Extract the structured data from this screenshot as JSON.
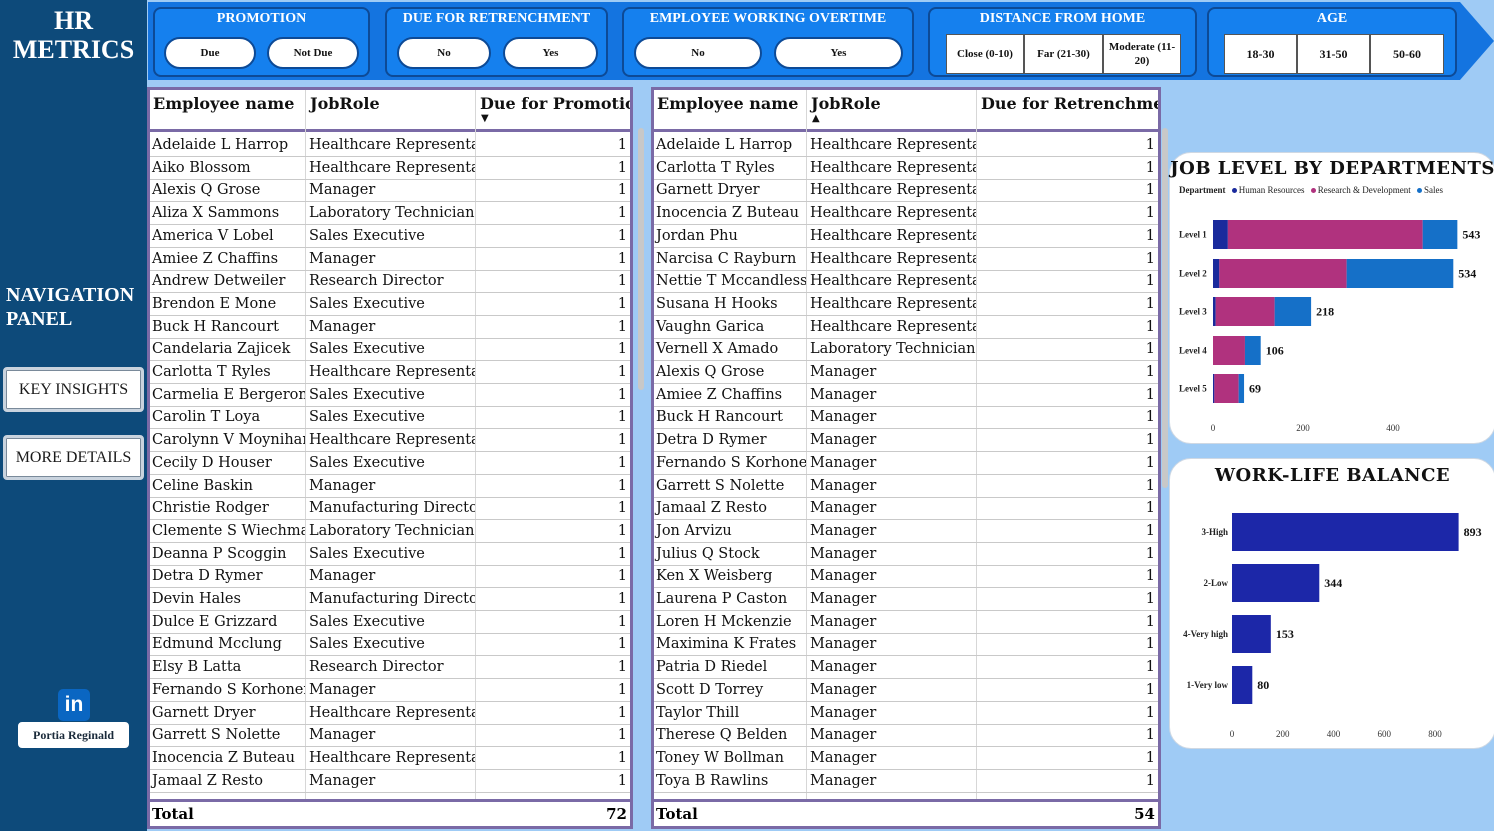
{
  "sidebar": {
    "title_line1": "HR",
    "title_line2": "METRICS",
    "nav_title_line1": "NAVIGATION",
    "nav_title_line2": "PANEL",
    "btn_key_insights": "KEY INSIGHTS",
    "btn_more_details": "MORE DETAILS",
    "linkedin_icon": "in",
    "author": "Portia Reginald"
  },
  "slicers": {
    "promotion": {
      "title": "PROMOTION",
      "options": [
        "Due",
        "Not Due"
      ]
    },
    "retrenchment": {
      "title": "DUE FOR RETRENCHMENT",
      "options": [
        "No",
        "Yes"
      ]
    },
    "overtime": {
      "title": "EMPLOYEE WORKING OVERTIME",
      "options": [
        "No",
        "Yes"
      ]
    },
    "distance": {
      "title": "DISTANCE FROM HOME",
      "options": [
        "Close (0-10)",
        "Far (21-30)",
        "Moderate (11-20)"
      ]
    },
    "age": {
      "title": "AGE",
      "options": [
        "18-30",
        "31-50",
        "50-60"
      ]
    }
  },
  "promotion_table": {
    "headers": [
      "Employee name",
      "JobRole",
      "Due for Promotion"
    ],
    "sort_indicator": "▼",
    "rows": [
      [
        "Adelaide L Harrop",
        "Healthcare Representative",
        "1"
      ],
      [
        "Aiko Blossom",
        "Healthcare Representative",
        "1"
      ],
      [
        "Alexis Q Grose",
        "Manager",
        "1"
      ],
      [
        "Aliza X Sammons",
        "Laboratory Technician",
        "1"
      ],
      [
        "America V Lobel",
        "Sales Executive",
        "1"
      ],
      [
        "Amiee Z Chaffins",
        "Manager",
        "1"
      ],
      [
        "Andrew Detweiler",
        "Research Director",
        "1"
      ],
      [
        "Brendon E Mone",
        "Sales Executive",
        "1"
      ],
      [
        "Buck H Rancourt",
        "Manager",
        "1"
      ],
      [
        "Candelaria Zajicek",
        "Sales Executive",
        "1"
      ],
      [
        "Carlotta T Ryles",
        "Healthcare Representative",
        "1"
      ],
      [
        "Carmelia E Bergeron",
        "Sales Executive",
        "1"
      ],
      [
        "Carolin T Loya",
        "Sales Executive",
        "1"
      ],
      [
        "Carolynn V Moynihan",
        "Healthcare Representative",
        "1"
      ],
      [
        "Cecily D Houser",
        "Sales Executive",
        "1"
      ],
      [
        "Celine Baskin",
        "Manager",
        "1"
      ],
      [
        "Christie Rodger",
        "Manufacturing Director",
        "1"
      ],
      [
        "Clemente S Wiechmann",
        "Laboratory Technician",
        "1"
      ],
      [
        "Deanna P Scoggin",
        "Sales Executive",
        "1"
      ],
      [
        "Detra D Rymer",
        "Manager",
        "1"
      ],
      [
        "Devin Hales",
        "Manufacturing Director",
        "1"
      ],
      [
        "Dulce E Grizzard",
        "Sales Executive",
        "1"
      ],
      [
        "Edmund Mcclung",
        "Sales Executive",
        "1"
      ],
      [
        "Elsy B Latta",
        "Research Director",
        "1"
      ],
      [
        "Fernando S Korhonen",
        "Manager",
        "1"
      ],
      [
        "Garnett Dryer",
        "Healthcare Representative",
        "1"
      ],
      [
        "Garrett S Nolette",
        "Manager",
        "1"
      ],
      [
        "Inocencia Z Buteau",
        "Healthcare Representative",
        "1"
      ],
      [
        "Jamaal Z Resto",
        "Manager",
        "1"
      ]
    ],
    "total_label": "Total",
    "total_value": "72"
  },
  "retrenchment_table": {
    "headers": [
      "Employee name",
      "JobRole",
      "Due for Retrenchment"
    ],
    "sort_indicator": "▲",
    "rows": [
      [
        "Adelaide L Harrop",
        "Healthcare Representative",
        "1"
      ],
      [
        "Carlotta T Ryles",
        "Healthcare Representative",
        "1"
      ],
      [
        "Garnett Dryer",
        "Healthcare Representative",
        "1"
      ],
      [
        "Inocencia Z Buteau",
        "Healthcare Representative",
        "1"
      ],
      [
        "Jordan Phu",
        "Healthcare Representative",
        "1"
      ],
      [
        "Narcisa C Rayburn",
        "Healthcare Representative",
        "1"
      ],
      [
        "Nettie T Mccandless",
        "Healthcare Representative",
        "1"
      ],
      [
        "Susana H Hooks",
        "Healthcare Representative",
        "1"
      ],
      [
        "Vaughn Garica",
        "Healthcare Representative",
        "1"
      ],
      [
        "Vernell X Amado",
        "Laboratory Technician",
        "1"
      ],
      [
        "Alexis Q Grose",
        "Manager",
        "1"
      ],
      [
        "Amiee Z Chaffins",
        "Manager",
        "1"
      ],
      [
        "Buck H Rancourt",
        "Manager",
        "1"
      ],
      [
        "Detra D Rymer",
        "Manager",
        "1"
      ],
      [
        "Fernando S Korhonen",
        "Manager",
        "1"
      ],
      [
        "Garrett S Nolette",
        "Manager",
        "1"
      ],
      [
        "Jamaal Z Resto",
        "Manager",
        "1"
      ],
      [
        "Jon Arvizu",
        "Manager",
        "1"
      ],
      [
        "Julius Q Stock",
        "Manager",
        "1"
      ],
      [
        "Ken X Weisberg",
        "Manager",
        "1"
      ],
      [
        "Laurena P Caston",
        "Manager",
        "1"
      ],
      [
        "Loren H Mckenzie",
        "Manager",
        "1"
      ],
      [
        "Maximina K Frates",
        "Manager",
        "1"
      ],
      [
        "Patria D Riedel",
        "Manager",
        "1"
      ],
      [
        "Scott D Torrey",
        "Manager",
        "1"
      ],
      [
        "Taylor Thill",
        "Manager",
        "1"
      ],
      [
        "Therese Q Belden",
        "Manager",
        "1"
      ],
      [
        "Toney W Bollman",
        "Manager",
        "1"
      ],
      [
        "Toya B Rawlins",
        "Manager",
        "1"
      ]
    ],
    "total_label": "Total",
    "total_value": "54"
  },
  "colors": {
    "human_resources": "#1a2a9c",
    "research_development": "#b0327e",
    "sales": "#1570c8",
    "work_life_bar": "#1c27a8"
  },
  "chart_data": [
    {
      "type": "bar",
      "orientation": "horizontal",
      "stacked": true,
      "title": "JOB LEVEL BY DEPARTMENTS",
      "legend_title": "Department",
      "legend_placement": "top-left",
      "categories": [
        "Level 1",
        "Level 2",
        "Level 3",
        "Level 4",
        "Level 5"
      ],
      "series": [
        {
          "name": "Human Resources",
          "values": [
            33,
            14,
            6,
            0,
            3
          ]
        },
        {
          "name": "Research & Development",
          "values": [
            433,
            283,
            131,
            71,
            54
          ]
        },
        {
          "name": "Sales",
          "values": [
            77,
            237,
            81,
            35,
            12
          ]
        }
      ],
      "totals": [
        543,
        534,
        218,
        106,
        69
      ],
      "x_ticks": [
        "0",
        "200",
        "400"
      ],
      "xlim": [
        0,
        560
      ],
      "grid": false
    },
    {
      "type": "bar",
      "orientation": "horizontal",
      "title": "WORK-LIFE BALANCE",
      "categories": [
        "3-High",
        "2-Low",
        "4-Very high",
        "1-Very low"
      ],
      "values": [
        893,
        344,
        153,
        80
      ],
      "x_ticks": [
        "0",
        "200",
        "400",
        "600",
        "800"
      ],
      "xlim": [
        0,
        900
      ],
      "grid": false
    }
  ]
}
